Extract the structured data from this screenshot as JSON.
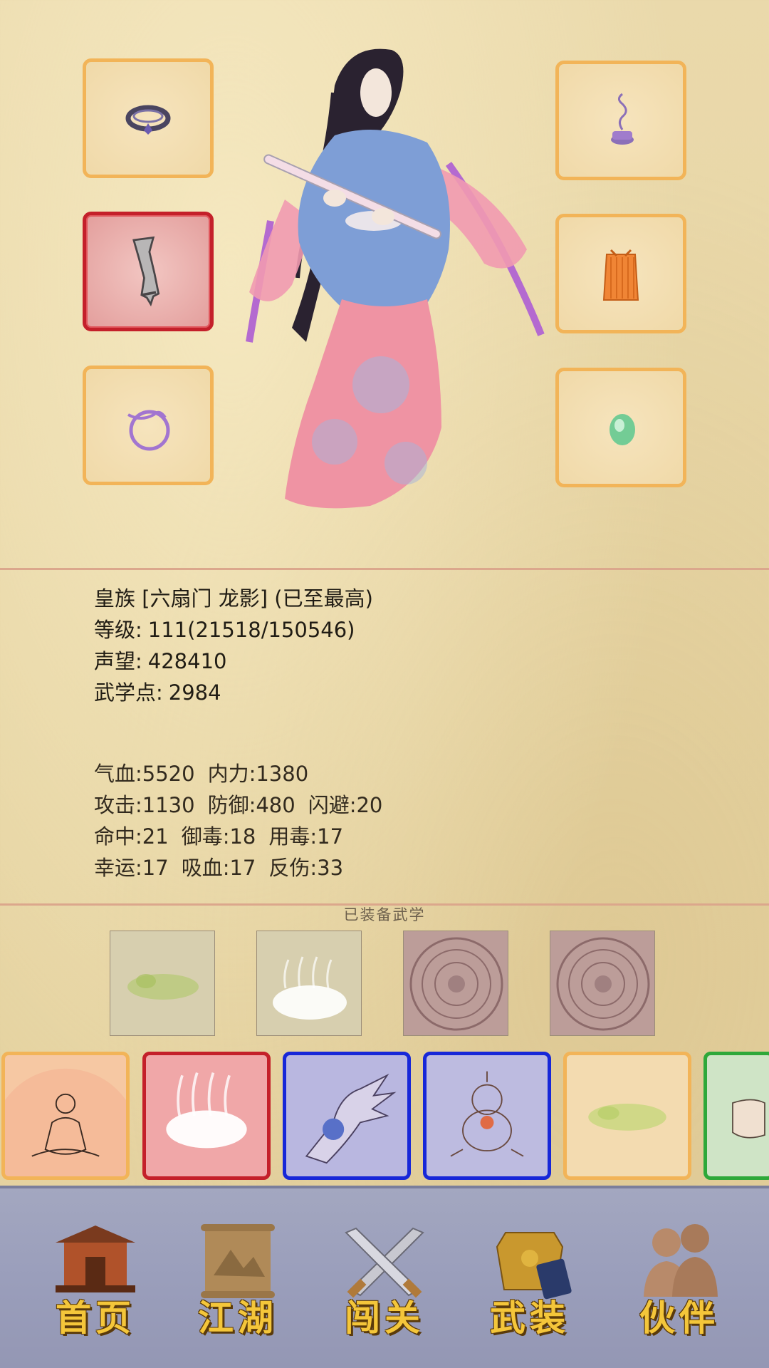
{
  "equipment_slots": [
    {
      "id": "ring",
      "icon": "ring-icon",
      "selected": false
    },
    {
      "id": "weapon",
      "icon": "broken-sword-icon",
      "selected": true
    },
    {
      "id": "bracelet",
      "icon": "bracelet-icon",
      "selected": false
    },
    {
      "id": "incense",
      "icon": "incense-icon",
      "selected": false
    },
    {
      "id": "armor",
      "icon": "robe-icon",
      "selected": false
    },
    {
      "id": "jade",
      "icon": "jade-icon",
      "selected": false
    }
  ],
  "character": {
    "title": "皇族 [六扇门 龙影] (已至最高)",
    "level_label": "等级:",
    "level_value": "111(21518/150546)",
    "fame_label": "声望:",
    "fame_value": "428410",
    "martial_points_label": "武学点:",
    "martial_points_value": "2984"
  },
  "stats": {
    "row1": [
      "气血:5520",
      "内力:1380"
    ],
    "row2": [
      "攻击:1130",
      "防御:480",
      "闪避:20"
    ],
    "row3": [
      "命中:21",
      "御毒:18",
      "用毒:17"
    ],
    "row4": [
      "幸运:17",
      "吸血:17",
      "反伤:33"
    ]
  },
  "equipped_martial": {
    "title": "已装备武学",
    "slots": [
      {
        "icon": "toad-skill-icon",
        "type": "texture"
      },
      {
        "icon": "mist-skill-icon",
        "type": "texture"
      },
      {
        "icon": "empty-seal-icon",
        "type": "seal"
      },
      {
        "icon": "empty-seal-icon",
        "type": "seal"
      }
    ]
  },
  "skill_pool": [
    {
      "icon": "meditation-icon",
      "border_color": "#f2b458",
      "bg": "#f6c8a3"
    },
    {
      "icon": "mist-icon",
      "border_color": "#c4202a",
      "bg": "#f0a7a8"
    },
    {
      "icon": "palm-strike-icon",
      "border_color": "#1727d8",
      "bg": "#b9b7e0"
    },
    {
      "icon": "gourd-icon",
      "border_color": "#1727d8",
      "bg": "#bdbbe0"
    },
    {
      "icon": "toad-icon",
      "border_color": "#f2b458",
      "bg": "#f3dbb0"
    },
    {
      "icon": "fist-icon",
      "border_color": "#2ea83a",
      "bg": "#cfe4c6"
    }
  ],
  "nav": {
    "home": "首页",
    "jianghu": "江湖",
    "challenge": "闯关",
    "equipment": "武装",
    "partner": "伙伴"
  }
}
